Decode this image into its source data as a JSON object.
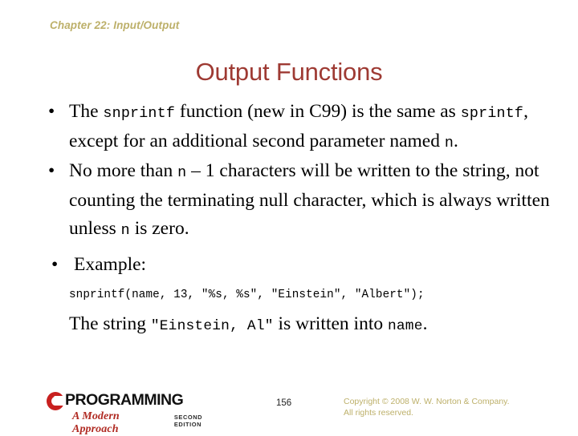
{
  "slide": {
    "chapter_header": "Chapter 22: Input/Output",
    "title": "Output Functions",
    "bullets": [
      {
        "marker": "•",
        "parts": [
          {
            "kind": "text",
            "text": "The "
          },
          {
            "kind": "code",
            "text": "snprintf"
          },
          {
            "kind": "text",
            "text": " function (new in C99) is the same as "
          },
          {
            "kind": "code",
            "text": "sprintf"
          },
          {
            "kind": "text",
            "text": ", except for an additional second parameter named "
          },
          {
            "kind": "code",
            "text": "n"
          },
          {
            "kind": "text",
            "text": "."
          }
        ]
      },
      {
        "marker": "•",
        "parts": [
          {
            "kind": "text",
            "text": "No more than "
          },
          {
            "kind": "code",
            "text": "n"
          },
          {
            "kind": "text",
            "text": " – 1 characters will be written to the string, not counting the terminating null character, which is always written unless "
          },
          {
            "kind": "code",
            "text": "n"
          },
          {
            "kind": "text",
            "text": " is zero."
          }
        ]
      },
      {
        "marker": "•",
        "parts": [
          {
            "kind": "text",
            "text": "Example:"
          }
        ]
      }
    ],
    "code_example": "snprintf(name, 13, \"%s, %s\", \"Einstein\", \"Albert\");",
    "result": {
      "parts": [
        {
          "kind": "text",
          "text": "The string "
        },
        {
          "kind": "code",
          "text": "\"Einstein, Al\""
        },
        {
          "kind": "text",
          "text": " is written into "
        },
        {
          "kind": "code",
          "text": "name"
        },
        {
          "kind": "text",
          "text": "."
        }
      ]
    }
  },
  "footer": {
    "logo": {
      "c_letter": "C",
      "word": "PROGRAMMING",
      "tagline": "A Modern Approach",
      "edition": "Second Edition"
    },
    "page_number": "156",
    "copyright_line1": "Copyright © 2008 W. W. Norton & Company.",
    "copyright_line2": "All rights reserved."
  },
  "colors": {
    "title_red": "#9e3a33",
    "header_olive": "#bdb06a",
    "logo_red": "#c8201f",
    "tagline_red": "#b02a22",
    "body_text": "#000000",
    "background": "#ffffff"
  }
}
